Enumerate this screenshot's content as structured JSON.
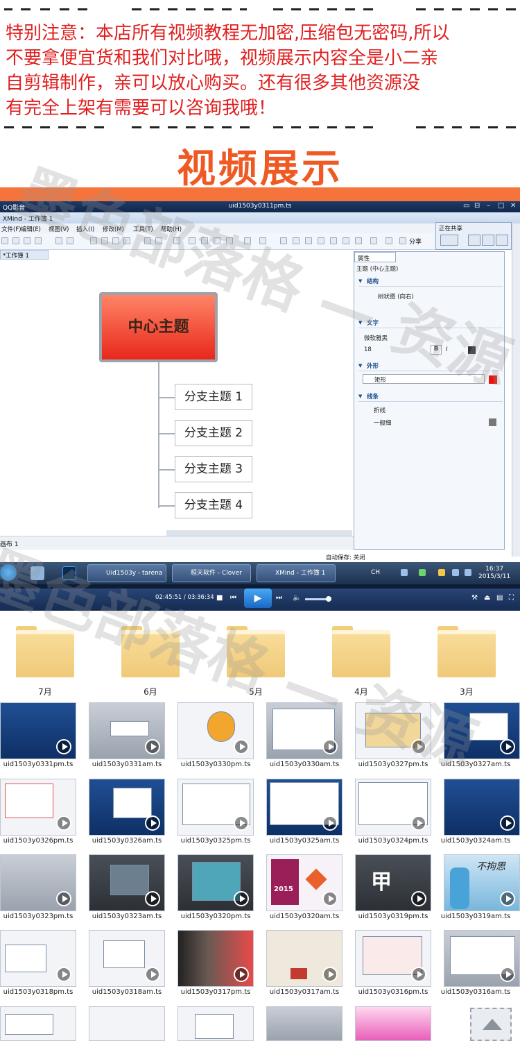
{
  "notice": {
    "lines": [
      "特别注意：本店所有视频教程无加密,压缩包无密码,所以",
      "不要拿便宜货和我们对比哦，视频展示内容全是小二亲",
      "自剪辑制作，亲可以放心购买。还有很多其他资源没",
      "有完全上架有需要可以咨询我哦！"
    ]
  },
  "banner_title": "视频展示",
  "player": {
    "app_name": "QQ影音",
    "file_title": "uid1503y0311pm.ts",
    "time": "02:45:51 / 03:36:34"
  },
  "xmind": {
    "window_title": "XMind - 工作簿 1",
    "menu": [
      "文件(F)",
      "编辑(E)",
      "视图(V)",
      "插入(I)",
      "修改(M)",
      "工具(T)",
      "帮助(H)"
    ],
    "share_label": "分享",
    "sharing_panel_title": "正在共享",
    "workbook_tab": "*工作簿 1",
    "central_topic": "中心主题",
    "branches": [
      "分支主题 1",
      "分支主题 2",
      "分支主题 3",
      "分支主题 4"
    ],
    "sheet_tab": "画布 1",
    "autosave": "自动保存: 关闭",
    "properties": {
      "tab": "属性",
      "subject": "主题 (中心主题)",
      "structure_header": "结构",
      "structure_value": "树状图 (向右)",
      "text_header": "文字",
      "font": "微软雅黑",
      "font_size": "18",
      "shape_header": "外形",
      "shape_value": "矩形",
      "line_header": "线条",
      "line_value": "折线",
      "line_width": "一般细",
      "shape_color": "#e8140e"
    }
  },
  "taskbar": {
    "buttons": [
      "Uid1503y - tarena",
      "桓天软件 - Clover",
      "XMind - 工作簿 1"
    ],
    "ime": "CH",
    "time": "16:37",
    "date": "2015/3/11"
  },
  "folders": [
    "7月",
    "6月",
    "5月",
    "4月",
    "3月"
  ],
  "files": [
    [
      "uid1503y0331pm.ts",
      "uid1503y0331am.ts",
      "uid1503y0330pm.ts",
      "uid1503y0330am.ts",
      "uid1503y0327pm.ts",
      "uid1503y0327am.ts"
    ],
    [
      "uid1503y0326pm.ts",
      "uid1503y0326am.ts",
      "uid1503y0325pm.ts",
      "uid1503y0325am.ts",
      "uid1503y0324pm.ts",
      "uid1503y0324am.ts"
    ],
    [
      "uid1503y0323pm.ts",
      "uid1503y0323am.ts",
      "uid1503y0320pm.ts",
      "uid1503y0320am.ts",
      "uid1503y0319pm.ts",
      "uid1503y0319am.ts"
    ],
    [
      "uid1503y0318pm.ts",
      "uid1503y0318am.ts",
      "uid1503y0317pm.ts",
      "uid1503y0317am.ts",
      "uid1503y0316pm.ts",
      "uid1503y0316am.ts"
    ]
  ],
  "thumb_text": {
    "year": "2015",
    "char_a": "甲",
    "char_b": "不拘思"
  },
  "watermark": "墨色部落格 — 资源",
  "colors": {
    "notice_red": "#e02020",
    "banner_orange": "#ef5a24",
    "player_blue": "#1a68c4",
    "folder_yellow": "#f0c979"
  }
}
